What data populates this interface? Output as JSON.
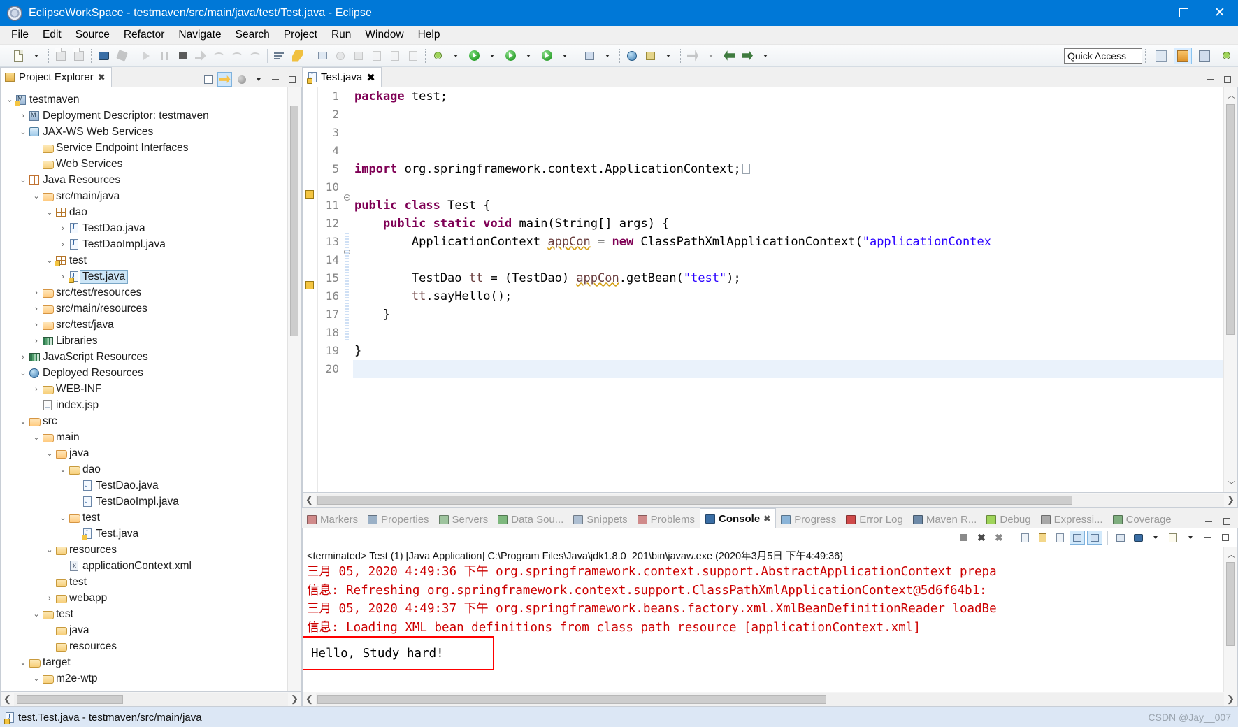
{
  "window": {
    "title": "EclipseWorkSpace - testmaven/src/main/java/test/Test.java - Eclipse",
    "icon": "eclipse-icon",
    "minimize": "minimize-icon",
    "maximize": "maximize-icon",
    "close": "×"
  },
  "menu": [
    "File",
    "Edit",
    "Source",
    "Refactor",
    "Navigate",
    "Search",
    "Project",
    "Run",
    "Window",
    "Help"
  ],
  "toolbar": {
    "quick_access_value": "Quick Access",
    "quick_access_placeholder": "Quick Access"
  },
  "project_explorer": {
    "tab_label": "Project Explorer",
    "close_glyph": "✖",
    "tree": [
      {
        "indent": 0,
        "arrow": "v",
        "icon": "maven-project-icon",
        "label": "testmaven",
        "selected": false
      },
      {
        "indent": 1,
        "arrow": ">",
        "icon": "deployment-descriptor-icon",
        "label": "Deployment Descriptor: testmaven",
        "selected": false
      },
      {
        "indent": 1,
        "arrow": "v",
        "icon": "jaxws-icon",
        "label": "JAX-WS Web Services",
        "selected": false
      },
      {
        "indent": 2,
        "arrow": "",
        "icon": "service-endpoint-icon",
        "label": "Service Endpoint Interfaces",
        "selected": false
      },
      {
        "indent": 2,
        "arrow": "",
        "icon": "web-services-icon",
        "label": "Web Services",
        "selected": false
      },
      {
        "indent": 1,
        "arrow": "v",
        "icon": "java-resources-icon",
        "label": "Java Resources",
        "selected": false
      },
      {
        "indent": 2,
        "arrow": "v",
        "icon": "source-folder-icon",
        "label": "src/main/java",
        "selected": false
      },
      {
        "indent": 3,
        "arrow": "v",
        "icon": "package-icon",
        "label": "dao",
        "selected": false
      },
      {
        "indent": 4,
        "arrow": ">",
        "icon": "java-interface-icon",
        "label": "TestDao.java",
        "selected": false
      },
      {
        "indent": 4,
        "arrow": ">",
        "icon": "java-class-icon",
        "label": "TestDaoImpl.java",
        "selected": false
      },
      {
        "indent": 3,
        "arrow": "v",
        "icon": "package-warning-icon",
        "label": "test",
        "selected": false
      },
      {
        "indent": 4,
        "arrow": ">",
        "icon": "java-class-warning-icon",
        "label": "Test.java",
        "selected": true
      },
      {
        "indent": 2,
        "arrow": ">",
        "icon": "source-folder-icon",
        "label": "src/test/resources",
        "selected": false
      },
      {
        "indent": 2,
        "arrow": ">",
        "icon": "source-folder-icon",
        "label": "src/main/resources",
        "selected": false
      },
      {
        "indent": 2,
        "arrow": ">",
        "icon": "source-folder-icon",
        "label": "src/test/java",
        "selected": false
      },
      {
        "indent": 2,
        "arrow": ">",
        "icon": "libraries-icon",
        "label": "Libraries",
        "selected": false
      },
      {
        "indent": 1,
        "arrow": ">",
        "icon": "libraries-icon",
        "label": "JavaScript Resources",
        "selected": false
      },
      {
        "indent": 1,
        "arrow": "v",
        "icon": "deployed-resources-icon",
        "label": "Deployed Resources",
        "selected": false
      },
      {
        "indent": 2,
        "arrow": ">",
        "icon": "folder-icon",
        "label": "WEB-INF",
        "selected": false
      },
      {
        "indent": 2,
        "arrow": "",
        "icon": "jsp-file-icon",
        "label": "index.jsp",
        "selected": false
      },
      {
        "indent": 1,
        "arrow": "v",
        "icon": "source-folder-icon",
        "label": "src",
        "selected": false
      },
      {
        "indent": 2,
        "arrow": "v",
        "icon": "source-folder-icon",
        "label": "main",
        "selected": false
      },
      {
        "indent": 3,
        "arrow": "v",
        "icon": "source-folder-icon",
        "label": "java",
        "selected": false
      },
      {
        "indent": 4,
        "arrow": "v",
        "icon": "folder-icon",
        "label": "dao",
        "selected": false
      },
      {
        "indent": 5,
        "arrow": "",
        "icon": "java-class-icon",
        "label": "TestDao.java",
        "selected": false
      },
      {
        "indent": 5,
        "arrow": "",
        "icon": "java-class-icon",
        "label": "TestDaoImpl.java",
        "selected": false
      },
      {
        "indent": 4,
        "arrow": "v",
        "icon": "source-folder-icon",
        "label": "test",
        "selected": false
      },
      {
        "indent": 5,
        "arrow": "",
        "icon": "java-class-warning-icon",
        "label": "Test.java",
        "selected": false
      },
      {
        "indent": 3,
        "arrow": "v",
        "icon": "folder-icon",
        "label": "resources",
        "selected": false
      },
      {
        "indent": 4,
        "arrow": "",
        "icon": "xml-file-icon",
        "label": "applicationContext.xml",
        "selected": false
      },
      {
        "indent": 3,
        "arrow": "",
        "icon": "folder-icon",
        "label": "test",
        "selected": false
      },
      {
        "indent": 3,
        "arrow": ">",
        "icon": "folder-icon",
        "label": "webapp",
        "selected": false
      },
      {
        "indent": 2,
        "arrow": "v",
        "icon": "folder-icon",
        "label": "test",
        "selected": false
      },
      {
        "indent": 3,
        "arrow": "",
        "icon": "folder-icon",
        "label": "java",
        "selected": false
      },
      {
        "indent": 3,
        "arrow": "",
        "icon": "folder-icon",
        "label": "resources",
        "selected": false
      },
      {
        "indent": 1,
        "arrow": "v",
        "icon": "folder-icon",
        "label": "target",
        "selected": false
      },
      {
        "indent": 2,
        "arrow": "v",
        "icon": "folder-icon",
        "label": "m2e-wtp",
        "selected": false
      }
    ]
  },
  "editor": {
    "tab_label": "Test.java",
    "close_glyph": "✖",
    "line_numbers": [
      "1",
      "2",
      "3",
      "4",
      "5",
      "10",
      "11",
      "12",
      "13",
      "14",
      "15",
      "16",
      "17",
      "18",
      "19",
      "20"
    ],
    "lines": [
      "package test;",
      "",
      "",
      "",
      "import org.springframework.context.ApplicationContext;",
      "",
      "public class Test {",
      "    public static void main(String[] args) {",
      "        ApplicationContext appCon = new ClassPathXmlApplicationContext(\"applicationContex",
      "",
      "        TestDao tt = (TestDao) appCon.getBean(\"test\");",
      "        tt.sayHello();",
      "    }",
      "",
      "}",
      ""
    ],
    "current_line_index": 15
  },
  "console": {
    "tabs": [
      {
        "label": "Markers",
        "icon": "markers-icon",
        "active": false
      },
      {
        "label": "Properties",
        "icon": "properties-icon",
        "active": false
      },
      {
        "label": "Servers",
        "icon": "servers-icon",
        "active": false
      },
      {
        "label": "Data Sou...",
        "icon": "data-source-icon",
        "active": false
      },
      {
        "label": "Snippets",
        "icon": "snippets-icon",
        "active": false
      },
      {
        "label": "Problems",
        "icon": "problems-icon",
        "active": false
      },
      {
        "label": "Console",
        "icon": "console-icon",
        "active": true
      },
      {
        "label": "Progress",
        "icon": "progress-icon",
        "active": false
      },
      {
        "label": "Error Log",
        "icon": "error-log-icon",
        "active": false
      },
      {
        "label": "Maven R...",
        "icon": "maven-icon",
        "active": false
      },
      {
        "label": "Debug",
        "icon": "debug-icon",
        "active": false
      },
      {
        "label": "Expressi...",
        "icon": "expressions-icon",
        "active": false
      },
      {
        "label": "Coverage",
        "icon": "coverage-icon",
        "active": false
      }
    ],
    "launch_header": "<terminated> Test (1) [Java Application] C:\\Program Files\\Java\\jdk1.8.0_201\\bin\\javaw.exe (2020年3月5日 下午4:49:36)",
    "output_lines": [
      "三月 05, 2020 4:49:36 下午 org.springframework.context.support.AbstractApplicationContext prepa",
      "信息: Refreshing org.springframework.context.support.ClassPathXmlApplicationContext@5d6f64b1:",
      "三月 05, 2020 4:49:37 下午 org.springframework.beans.factory.xml.XmlBeanDefinitionReader loadBe",
      "信息: Loading XML bean definitions from class path resource [applicationContext.xml]"
    ],
    "highlighted_output": "Hello, Study hard!",
    "highlight_color": "#ff0000"
  },
  "status": {
    "icon": "java-class-warning-icon",
    "text": "test.Test.java - testmaven/src/main/java",
    "watermark": "CSDN @Jay__007"
  }
}
